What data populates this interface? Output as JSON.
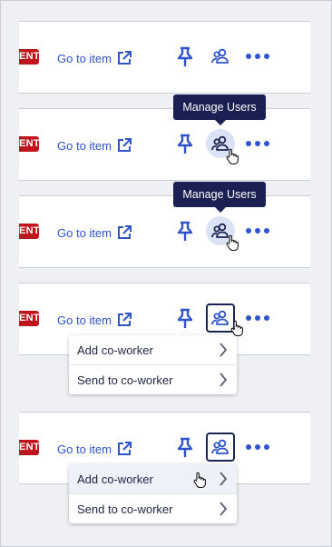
{
  "rows": [
    {
      "badge": "ENT",
      "goto_label": "Go to item"
    },
    {
      "badge": "ENT",
      "goto_label": "Go to item"
    },
    {
      "badge": "ENT",
      "goto_label": "Go to item"
    },
    {
      "badge": "ENT",
      "goto_label": "Go to item"
    },
    {
      "badge": "ENT",
      "goto_label": "Go to item"
    }
  ],
  "tooltip": {
    "text": "Manage Users"
  },
  "menu": {
    "items": [
      {
        "label": "Add co-worker"
      },
      {
        "label": "Send to co-worker"
      }
    ]
  },
  "colors": {
    "accent": "#2f54c9",
    "badge": "#c0141c",
    "tooltip": "#1a2152",
    "hover_circle": "#dce2f5"
  },
  "icons": [
    "external-link-icon",
    "pin-icon",
    "users-icon",
    "more-dots-icon",
    "chevron-right-icon",
    "hand-cursor-icon"
  ]
}
